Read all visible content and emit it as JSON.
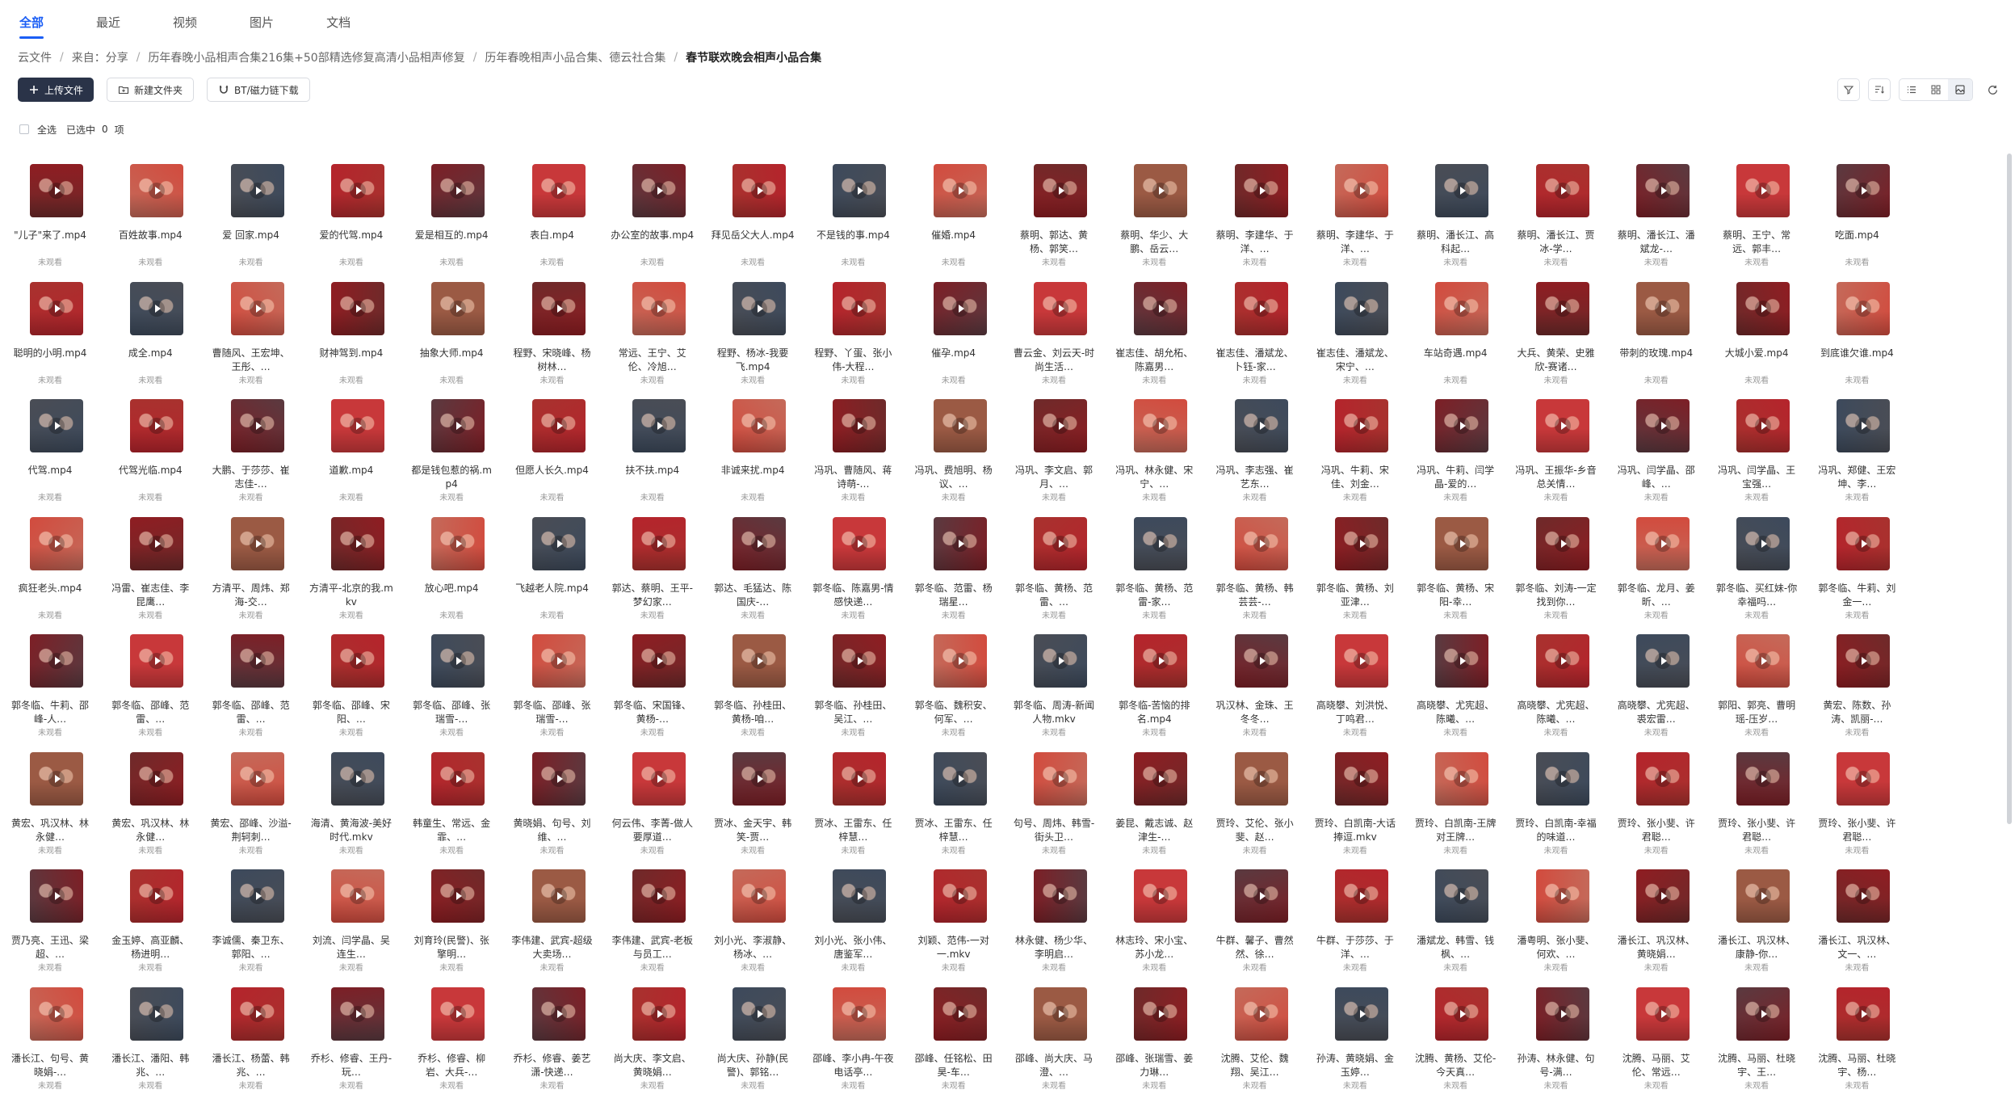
{
  "tabs": [
    {
      "label": "全部",
      "active": true
    },
    {
      "label": "最近"
    },
    {
      "label": "视频"
    },
    {
      "label": "图片"
    },
    {
      "label": "文档"
    }
  ],
  "breadcrumb": [
    "云文件",
    "来自：分享",
    "历年春晚小品相声合集216集+50部精选修复高清小品相声修复",
    "历年春晚相声小品合集、德云社合集",
    "春节联欢晚会相声小品合集"
  ],
  "toolbar": {
    "upload": "上传文件",
    "new_folder": "新建文件夹",
    "bt_download": "BT/磁力链下载"
  },
  "selection": {
    "select_all": "全选",
    "selected_prefix": "已选中",
    "count": "0",
    "unit": "项"
  },
  "status_label": "未观看",
  "thumb_palette": [
    "#b5242c",
    "#8f1d22",
    "#c8383a",
    "#6e2a2a",
    "#a8322e",
    "#4a4d55",
    "#d24b3e",
    "#7d1f26",
    "#9b5a44",
    "#5a3a40",
    "#c46a5a",
    "#3d4a5c"
  ],
  "files": [
    "\"儿子\"来了.mp4",
    "百姓故事.mp4",
    "爱 回家.mp4",
    "爱的代驾.mp4",
    "爱是相互的.mp4",
    "表白.mp4",
    "办公室的故事.mp4",
    "拜见岳父大人.mp4",
    "不是钱的事.mp4",
    "催婚.mp4",
    "蔡明、郭达、黄杨、郭笑…",
    "蔡明、华少、大鹏、岳云…",
    "蔡明、李建华、于洋、…",
    "蔡明、李建华、于洋、…",
    "蔡明、潘长江、高科起…",
    "蔡明、潘长江、贾冰-学…",
    "蔡明、潘长江、潘斌龙-…",
    "蔡明、王宁、常远、郭丰…",
    "吃面.mp4",
    "聪明的小明.mp4",
    "成全.mp4",
    "曹随风、王宏坤、王彤、…",
    "财神驾到.mp4",
    "抽象大师.mp4",
    "程野、宋晓峰、杨树林…",
    "常远、王宁、艾伦、冷旭…",
    "程野、杨冰-我要飞.mp4",
    "程野、丫蛋、张小伟-大程…",
    "催孕.mp4",
    "曹云金、刘云天-时尚生活…",
    "崔志佳、胡允柘、陈嘉男…",
    "崔志佳、潘斌龙、卜钰-家…",
    "崔志佳、潘斌龙、宋宁、…",
    "车站奇遇.mp4",
    "大兵、黄荣、史雅欣-赛诸…",
    "带刺的玫瑰.mp4",
    "大城小爱.mp4",
    "到底谁欠谁.mp4",
    "代驾.mp4",
    "代驾光临.mp4",
    "大鹏、于莎莎、崔志佳-…",
    "道歉.mp4",
    "都是钱包惹的祸.mp4",
    "但愿人长久.mp4",
    "扶不扶.mp4",
    "非诚来扰.mp4",
    "冯巩、曹随风、蒋诗萌-…",
    "冯巩、费旭明、杨议、…",
    "冯巩、李文启、郭月、…",
    "冯巩、林永健、宋宁、…",
    "冯巩、李志强、崔艺东…",
    "冯巩、牛莉、宋佳、刘金…",
    "冯巩、牛莉、闫学晶-爱的…",
    "冯巩、王振华-乡音总关情…",
    "冯巩、闫学晶、邵峰、…",
    "冯巩、闫学晶、王宝强…",
    "冯巩、郑健、王宏坤、李…",
    "疯狂老头.mp4",
    "冯雷、崔志佳、李昆鹰…",
    "方清平、周炜、郑海-交…",
    "方清平-北京的我.mkv",
    "放心吧.mp4",
    "飞越老人院.mp4",
    "郭达、蔡明、王平-梦幻家…",
    "郭达、毛猛达、陈国庆-…",
    "郭冬临、陈嘉男-情感快递…",
    "郭冬临、范雷、杨瑞星…",
    "郭冬临、黄杨、范雷、…",
    "郭冬临、黄杨、范雷-家…",
    "郭冬临、黄杨、韩芸芸-…",
    "郭冬临、黄杨、刘亚津…",
    "郭冬临、黄杨、宋阳-幸…",
    "郭冬临、刘涛-一定找到你…",
    "郭冬临、龙月、姜昕、…",
    "郭冬临、买红妹-你幸福吗…",
    "郭冬临、牛莉、刘金一…",
    "郭冬临、牛莉、邵峰-人…",
    "郭冬临、邵峰、范雷、…",
    "郭冬临、邵峰、范雷、…",
    "郭冬临、邵峰、宋阳、…",
    "郭冬临、邵峰、张瑞雪-…",
    "郭冬临、邵峰、张瑞雪-…",
    "郭冬临、宋国锋、黄杨-…",
    "郭冬临、孙桂田、黄杨-咱…",
    "郭冬临、孙桂田、吴江、…",
    "郭冬临、魏积安、何军、…",
    "郭冬临、周涛-新闻人物.mkv",
    "郭冬临-苦恼的排名.mp4",
    "巩汉林、金珠、王冬冬…",
    "高晓攀、刘洪悦、丁鸣君…",
    "高晓攀、尤宪超、陈曦、…",
    "高晓攀、尤宪超、陈曦、…",
    "高晓攀、尤宪超、裘宏雷…",
    "郭阳、郭亮、曹明瑶-压岁…",
    "黄宏、陈数、孙涛、凯丽-…",
    "黄宏、巩汉林、林永健…",
    "黄宏、巩汉林、林永健…",
    "黄宏、邵峰、沙溢-荆轲刺…",
    "海清、黄海波-美好时代.mkv",
    "韩童生、常远、金霏、…",
    "黄晓娟、句号、刘维、…",
    "何云伟、李菁-做人要厚道…",
    "贾冰、金天宇、韩笑-贾…",
    "贾冰、王雷东、任梓慧…",
    "贾冰、王雷东、任梓慧…",
    "句号、周炜、韩雪-街头卫…",
    "姜昆、戴志诚、赵津生-…",
    "贾玲、艾伦、张小斐、赵…",
    "贾玲、白凯南-大话捧逗.mkv",
    "贾玲、白凯南-王牌对王牌…",
    "贾玲、白凯南-幸福的味道…",
    "贾玲、张小斐、许君聪…",
    "贾玲、张小斐、许君聪…",
    "贾玲、张小斐、许君聪…",
    "贾乃亮、王迅、梁超、…",
    "金玉婷、高亚麟、杨进明…",
    "李诚儒、秦卫东、郭阳、…",
    "刘流、闫学晶、吴连生…",
    "刘育玲(民警)、张擎明…",
    "李伟建、武宾-超级大卖场…",
    "李伟建、武宾-老板与员工…",
    "刘小光、李淑静、杨冰、…",
    "刘小光、张小伟、唐鉴军…",
    "刘颖、范伟-一对一.mkv",
    "林永健、杨少华、李明启…",
    "林志玲、宋小宝、苏小龙…",
    "牛群、馨子、曹然然、徐…",
    "牛群、于莎莎、于洋、…",
    "潘斌龙、韩雪、钱枫、…",
    "潘粤明、张小斐、何欢、…",
    "潘长江、巩汉林、黄晓娟…",
    "潘长江、巩汉林、康静-你…",
    "潘长江、巩汉林、文一、…",
    "潘长江、句号、黄晓娟-…",
    "潘长江、潘阳、韩兆、…",
    "潘长江、杨蕾、韩兆、…",
    "乔杉、修睿、王丹-玩…",
    "乔杉、修睿、柳岩、大兵-…",
    "乔杉、修睿、姜艺潇-快递…",
    "尚大庆、李文启、黄晓娟…",
    "尚大庆、孙静(民警)、郭铭…",
    "邵峰、李小冉-午夜电话亭…",
    "邵峰、任铭松、田昊-车…",
    "邵峰、尚大庆、马澄、…",
    "邵峰、张瑞雪、姜力琳…",
    "沈腾、艾伦、魏翔、吴江…",
    "孙涛、黄晓娟、金玉婷…",
    "沈腾、黄杨、艾伦-今天真…",
    "孙涛、林永健、句号-满…",
    "沈腾、马丽、艾伦、常远…",
    "沈腾、马丽、杜晓宇、王…",
    "沈腾、马丽、杜晓宇、杨…"
  ]
}
